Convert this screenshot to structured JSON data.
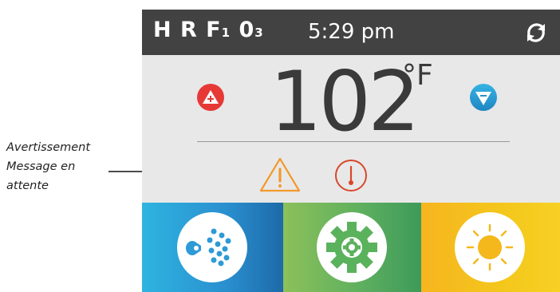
{
  "annotation": {
    "lines": [
      "Avertissement",
      "Message en",
      "attente"
    ]
  },
  "header": {
    "status_main_1": "H R F",
    "status_sub_1": "1",
    "status_main_2": " 0",
    "status_sub_2": "3",
    "time": "5:29 pm",
    "refresh_icon": "refresh-icon"
  },
  "temperature": {
    "value": "102",
    "unit": "°F",
    "up_icon": "up-arrow-icon",
    "down_icon": "down-arrow-icon"
  },
  "alerts": {
    "warning_icon": "warning-triangle-icon",
    "temperature_icon": "thermometer-alert-icon"
  },
  "tiles": [
    {
      "icon": "jets-icon"
    },
    {
      "icon": "gear-icon"
    },
    {
      "icon": "sun-icon"
    }
  ],
  "colors": {
    "header_bg": "#424242",
    "panel_bg": "#e8e8e8",
    "up_button": "#e63936",
    "down_button": "#2a9ed6",
    "warning": "#f29a2e",
    "temp_alert": "#d9472b"
  }
}
